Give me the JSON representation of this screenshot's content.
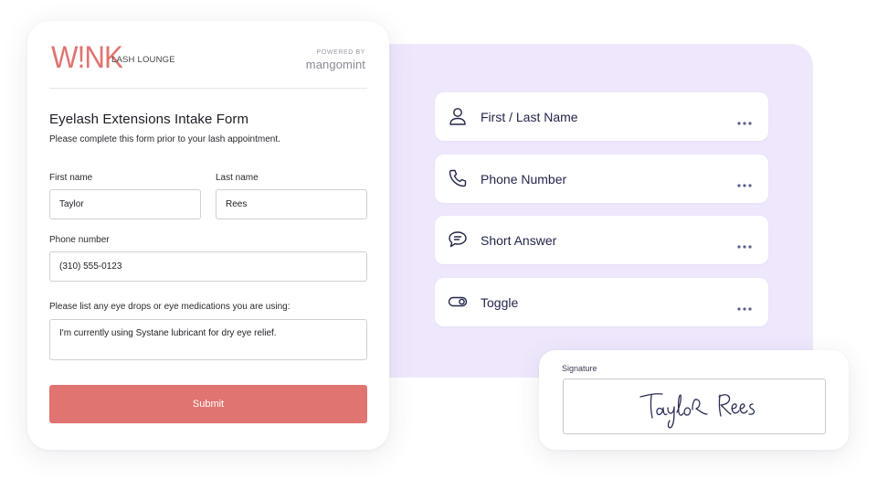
{
  "brand": {
    "logo_text": "W!NK",
    "tagline": "LASH LOUNGE",
    "powered_by": "POWERED BY",
    "platform": "mangomint",
    "accent_color": "#e07470"
  },
  "form": {
    "title": "Eyelash Extensions Intake Form",
    "subtitle": "Please complete this form prior to your lash appointment.",
    "fields": {
      "first_name": {
        "label": "First name",
        "value": "Taylor"
      },
      "last_name": {
        "label": "Last name",
        "value": "Rees"
      },
      "phone": {
        "label": "Phone number",
        "value": "(310) 555-0123"
      },
      "medications": {
        "label": "Please list any eye drops or eye medications you are using:",
        "value": "I'm currently using Systane lubricant for dry eye relief."
      }
    },
    "submit_label": "Submit"
  },
  "field_types": [
    {
      "label": "First / Last Name",
      "icon": "person-icon"
    },
    {
      "label": "Phone Number",
      "icon": "phone-icon"
    },
    {
      "label": "Short Answer",
      "icon": "speech-bubble-icon"
    },
    {
      "label": "Toggle",
      "icon": "toggle-icon"
    }
  ],
  "signature": {
    "label": "Signature",
    "value": "Taylor Rees"
  },
  "colors": {
    "panel_bg": "#efe8fd",
    "field_text": "#23264a",
    "submit_bg": "#e07470"
  }
}
